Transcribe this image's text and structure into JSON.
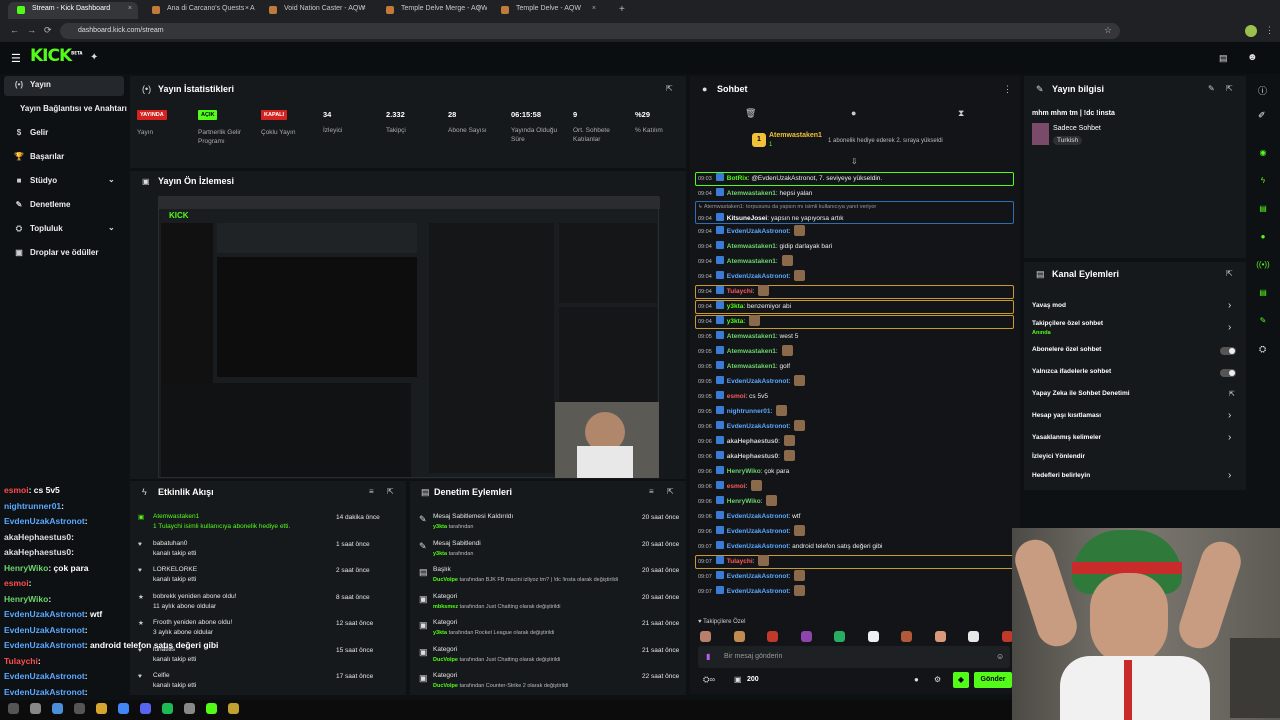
{
  "browser": {
    "tabs": [
      {
        "label": "Stream - Kick Dashboard",
        "active": true
      },
      {
        "label": "Ana di Carcano's Quests - AQW"
      },
      {
        "label": "Void Nation Caster - AQW"
      },
      {
        "label": "Temple Delve Merge - AQW"
      },
      {
        "label": "Temple Delve - AQW"
      }
    ],
    "new_tab": "+",
    "url": "dashboard.kick.com/stream"
  },
  "brand": {
    "logo": "KICK",
    "beta": "BETA",
    "accent": "#53fc18"
  },
  "sidebar": {
    "items": [
      {
        "label": "Yayın",
        "icon": "broadcast-icon"
      },
      {
        "label": "Yayın Bağlantısı ve Anahtarı"
      },
      {
        "label": "Gelir",
        "icon": "money-icon"
      },
      {
        "label": "Başarılar",
        "icon": "trophy-icon"
      },
      {
        "label": "Stüdyo",
        "icon": "studio-icon"
      },
      {
        "label": "Denetleme",
        "icon": "hammer-icon"
      },
      {
        "label": "Topluluk",
        "icon": "people-icon"
      },
      {
        "label": "Droplar ve ödüller",
        "icon": "gift-icon"
      }
    ]
  },
  "stats": {
    "title": "Yayın İstatistikleri",
    "items": [
      {
        "badge": "YAYINDA",
        "label": "Yayın"
      },
      {
        "badge": "AÇIK",
        "label": "Partnerlik Gelir Programı"
      },
      {
        "badge": "KAPALI",
        "label": "Çoklu Yayın"
      },
      {
        "value": "34",
        "label": "İzleyici"
      },
      {
        "value": "2.332",
        "label": "Takipçi"
      },
      {
        "value": "28",
        "label": "Abone Sayısı"
      },
      {
        "value": "06:15:58",
        "label": "Yayında Olduğu Süre"
      },
      {
        "value": "9",
        "label": "Ort. Sohbete Katılanlar"
      },
      {
        "value": "%29",
        "label": "% Katılım"
      }
    ]
  },
  "preview": {
    "title": "Yayın Ön İzlemesi"
  },
  "activity": {
    "title": "Etkinlik Akışı",
    "items": [
      {
        "user": "Atemwastaken1",
        "sub": "1 Tulaychi isimli kullanıcıya abonelik hediye etti.",
        "time": "14 dakika önce"
      },
      {
        "user": "babatuhan0",
        "sub": "kanalı takip etti",
        "time": "1 saat önce"
      },
      {
        "user": "LORKELORKE",
        "sub": "kanalı takip etti",
        "time": "2 saat önce"
      },
      {
        "user": "bobrekk yeniden abone oldu!",
        "sub": "11 aylık abone oldular",
        "time": "8 saat önce"
      },
      {
        "user": "Frooth yeniden abone oldu!",
        "sub": "3 aylık abone oldular",
        "time": "12 saat önce"
      },
      {
        "user": "lunatics",
        "sub": "kanalı takip etti",
        "time": "15 saat önce"
      },
      {
        "user": "Celfie",
        "sub": "kanalı takip etti",
        "time": "17 saat önce"
      }
    ]
  },
  "moderation": {
    "title": "Denetim Eylemleri",
    "items": [
      {
        "title": "Mesaj Sabitlemesi Kaldırıldı",
        "user": "y3kta",
        "rest": " tarafından",
        "time": "20 saat önce"
      },
      {
        "title": "Mesaj Sabitlendi",
        "user": "y3kta",
        "rest": " tarafından",
        "time": "20 saat önce"
      },
      {
        "title": "Başlık",
        "user": "DucVolpe",
        "rest": " tarafından BJK FB macini izliyoz tm? | !dc !insta olarak değiştirildi",
        "time": "20 saat önce"
      },
      {
        "title": "Kategori",
        "user": "mbksmez",
        "rest": " tarafından Just Chatting olarak değiştirildi",
        "time": "20 saat önce"
      },
      {
        "title": "Kategori",
        "user": "y3kta",
        "rest": " tarafından Rocket League olarak değiştirildi",
        "time": "21 saat önce"
      },
      {
        "title": "Kategori",
        "user": "DucVolpe",
        "rest": " tarafından Just Chatting olarak değiştirildi",
        "time": "21 saat önce"
      },
      {
        "title": "Kategori",
        "user": "DucVolpe",
        "rest": " tarafından Counter-Strike 2 olarak değiştirildi",
        "time": "22 saat önce"
      }
    ]
  },
  "chat": {
    "title": "Sohbet",
    "pinned": {
      "user": "Atemwastaken1",
      "count": "1",
      "text": "1 abonelik hediye ederek 2. sıraya yükseldi"
    },
    "messages": [
      {
        "time": "09:03",
        "user": "BotRix",
        "text": ": @EvdenUzakAstronot, 7. seviyeye yükseldin.",
        "color": "#53fc18",
        "box": "green"
      },
      {
        "time": "09:04",
        "user": "Atemwastaken1",
        "text": ": hepsi yalan",
        "color": "#6cd46c"
      },
      {
        "time": "09:04",
        "user": "KitsuneJosei",
        "text": ": yapsın ne yapıyorsa artık",
        "color": "#ffffff",
        "box": "blue",
        "reply": "Atemwastaken1: torpusunu da yapsın mı isimli kullanıcıya yanıt veriyor"
      },
      {
        "time": "09:04",
        "user": "EvdenUzakAstronot",
        "text": ":",
        "color": "#5aa8ff"
      },
      {
        "time": "09:04",
        "user": "Atemwastaken1",
        "text": ": gidip darlayak bari",
        "color": "#6cd46c"
      },
      {
        "time": "09:04",
        "user": "Atemwastaken1",
        "text": ":",
        "color": "#6cd46c"
      },
      {
        "time": "09:04",
        "user": "EvdenUzakAstronot",
        "text": ":",
        "color": "#5aa8ff"
      },
      {
        "time": "09:04",
        "user": "Tulaychi",
        "text": ":",
        "color": "#ff5a5a",
        "box": "gold"
      },
      {
        "time": "09:04",
        "user": "y3kta",
        "text": ": benzemiyor abi",
        "color": "#53fc18",
        "box": "gold"
      },
      {
        "time": "09:04",
        "user": "y3kta",
        "text": ":",
        "color": "#53fc18",
        "box": "gold"
      },
      {
        "time": "09:05",
        "user": "Atemwastaken1",
        "text": ": west 5",
        "color": "#6cd46c"
      },
      {
        "time": "09:05",
        "user": "Atemwastaken1",
        "text": ":",
        "color": "#6cd46c"
      },
      {
        "time": "09:05",
        "user": "Atemwastaken1",
        "text": ": golf",
        "color": "#6cd46c"
      },
      {
        "time": "09:05",
        "user": "EvdenUzakAstronot",
        "text": ":",
        "color": "#5aa8ff"
      },
      {
        "time": "09:05",
        "user": "esmoi",
        "text": ": cs 5v5",
        "color": "#ff5a5a"
      },
      {
        "time": "09:05",
        "user": "nightrunner01",
        "text": ":",
        "color": "#5aa8ff"
      },
      {
        "time": "09:06",
        "user": "EvdenUzakAstronot",
        "text": ":",
        "color": "#5aa8ff"
      },
      {
        "time": "09:06",
        "user": "akaHephaestus0",
        "text": ":",
        "color": "#cfcfcf"
      },
      {
        "time": "09:06",
        "user": "akaHephaestus0",
        "text": ":",
        "color": "#cfcfcf"
      },
      {
        "time": "09:06",
        "user": "HenryWiko",
        "text": ": çok para",
        "color": "#6cd46c"
      },
      {
        "time": "09:06",
        "user": "esmoi",
        "text": ":",
        "color": "#ff5a5a"
      },
      {
        "time": "09:06",
        "user": "HenryWiko",
        "text": ":",
        "color": "#6cd46c"
      },
      {
        "time": "09:06",
        "user": "EvdenUzakAstronot",
        "text": ": wtf",
        "color": "#5aa8ff"
      },
      {
        "time": "09:06",
        "user": "EvdenUzakAstronot",
        "text": ":",
        "color": "#5aa8ff"
      },
      {
        "time": "09:07",
        "user": "EvdenUzakAstronot",
        "text": ": android telefon satış değeri gibi",
        "color": "#5aa8ff"
      },
      {
        "time": "09:07",
        "user": "Tulaychi",
        "text": ":",
        "color": "#ff5a5a",
        "box": "gold"
      },
      {
        "time": "09:07",
        "user": "EvdenUzakAstronot",
        "text": ":",
        "color": "#5aa8ff"
      },
      {
        "time": "09:07",
        "user": "EvdenUzakAstronot",
        "text": ":",
        "color": "#5aa8ff"
      }
    ],
    "followers_only": "Takipçilere Özel",
    "input_placeholder": "Bir mesaj gönderin",
    "points": "200",
    "send": "Gönder"
  },
  "stream_info": {
    "title": "Yayın bilgisi",
    "stream_title": "mhm mhm tm | !dc !insta",
    "category": "Sadece Sohbet",
    "tag": "Turkish"
  },
  "channel_actions": {
    "title": "Kanal Eylemleri",
    "items": [
      {
        "label": "Yavaş mod",
        "kind": "chevron"
      },
      {
        "label": "Takipçilere özel sohbet",
        "sub": "Anında",
        "kind": "chevron"
      },
      {
        "label": "Abonelere özel sohbet",
        "kind": "toggle"
      },
      {
        "label": "Yalnızca ifadelerle sohbet",
        "kind": "toggle"
      },
      {
        "label": "Yapay Zeka ile Sohbet Denetimi",
        "kind": "external"
      },
      {
        "label": "Hesap yaşı kısıtlaması",
        "kind": "chevron"
      },
      {
        "label": "Yasaklanmış kelimeler",
        "kind": "chevron"
      },
      {
        "label": "İzleyici Yönlendir",
        "kind": "none"
      },
      {
        "label": "Hedefleri belirleyin",
        "kind": "chevron"
      }
    ]
  },
  "overlay_chat": [
    {
      "user": "esmoi",
      "text": ": cs 5v5",
      "color": "#ff4d4d"
    },
    {
      "user": "nightrunner01",
      "text": ":",
      "color": "#5aa8ff"
    },
    {
      "user": "EvdenUzakAstronot",
      "text": ":",
      "color": "#5aa8ff"
    },
    {
      "user": "akaHephaestus0",
      "text": ":",
      "color": "#dddddd"
    },
    {
      "user": "akaHephaestus0",
      "text": ":",
      "color": "#dddddd"
    },
    {
      "user": "HenryWiko",
      "text": ": çok para",
      "color": "#6cd46c"
    },
    {
      "user": "esmoi",
      "text": ":",
      "color": "#ff4d4d"
    },
    {
      "user": "HenryWiko",
      "text": ":",
      "color": "#6cd46c"
    },
    {
      "user": "EvdenUzakAstronot",
      "text": ": wtf",
      "color": "#5aa8ff"
    },
    {
      "user": "EvdenUzakAstronot",
      "text": ":",
      "color": "#5aa8ff"
    },
    {
      "user": "EvdenUzakAstronot",
      "text": ": android telefon satış değeri gibi",
      "color": "#5aa8ff"
    },
    {
      "user": "Tulaychi",
      "text": ":",
      "color": "#ff4d4d"
    },
    {
      "user": "EvdenUzakAstronot",
      "text": ":",
      "color": "#5aa8ff"
    },
    {
      "user": "EvdenUzakAstronot",
      "text": ":",
      "color": "#5aa8ff"
    }
  ]
}
